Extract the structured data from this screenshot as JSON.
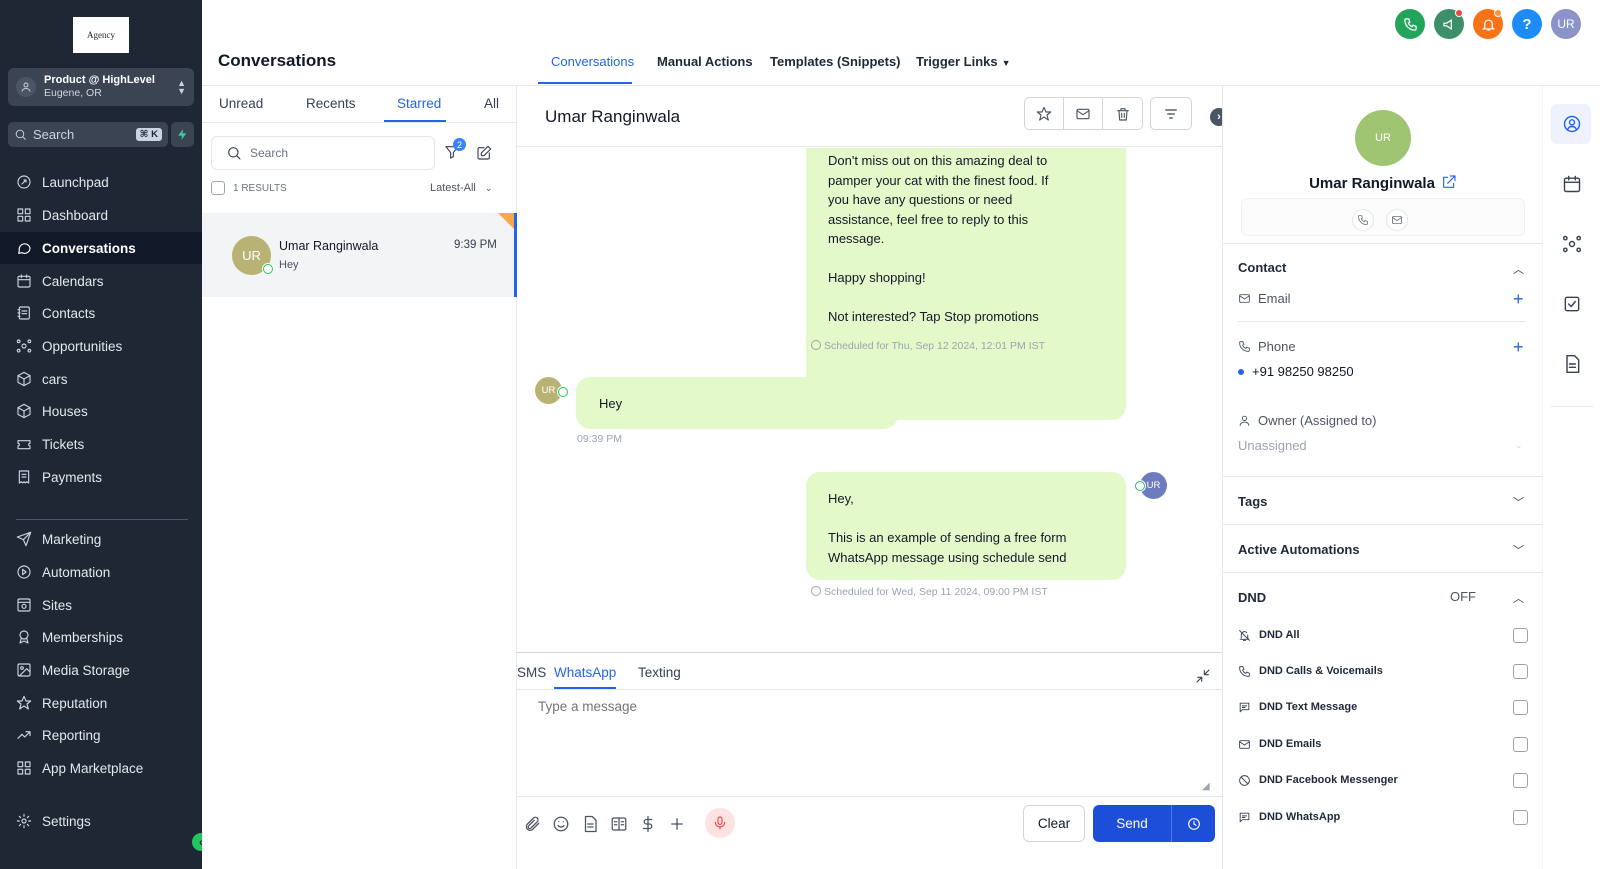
{
  "sidebar": {
    "logo_text": "Agency",
    "account": {
      "name": "Product @ HighLevel",
      "location": "Eugene, OR"
    },
    "search": {
      "placeholder": "Search",
      "shortcut": "⌘ K"
    },
    "nav_items": [
      {
        "label": "Launchpad",
        "icon": "rocket-icon"
      },
      {
        "label": "Dashboard",
        "icon": "grid-icon"
      },
      {
        "label": "Conversations",
        "icon": "chat-icon",
        "active": true
      },
      {
        "label": "Calendars",
        "icon": "calendar-icon"
      },
      {
        "label": "Contacts",
        "icon": "contacts-icon"
      },
      {
        "label": "Opportunities",
        "icon": "network-icon"
      },
      {
        "label": "cars",
        "icon": "box-icon"
      },
      {
        "label": "Houses",
        "icon": "box-icon"
      },
      {
        "label": "Tickets",
        "icon": "ticket-icon"
      },
      {
        "label": "Payments",
        "icon": "receipt-icon"
      }
    ],
    "nav_items_2": [
      {
        "label": "Marketing",
        "icon": "send-icon"
      },
      {
        "label": "Automation",
        "icon": "automation-icon"
      },
      {
        "label": "Sites",
        "icon": "globe-icon"
      },
      {
        "label": "Memberships",
        "icon": "award-icon"
      },
      {
        "label": "Media Storage",
        "icon": "image-icon"
      },
      {
        "label": "Reputation",
        "icon": "star-icon"
      },
      {
        "label": "Reporting",
        "icon": "trend-icon"
      },
      {
        "label": "App Marketplace",
        "icon": "grid-icon"
      }
    ],
    "settings_label": "Settings"
  },
  "header": {
    "title": "Conversations",
    "tabs": [
      "Conversations",
      "Manual Actions",
      "Templates (Snippets)",
      "Trigger Links"
    ],
    "active_tab": "Conversations",
    "user_initials": "UR",
    "colors": {
      "phone": "#22a55a",
      "announce": "#3d8f6a",
      "bell": "#f97316",
      "help": "#1d8cf8",
      "user": "#8b93c9"
    }
  },
  "conversation_list": {
    "filter_tabs": [
      "Unread",
      "Recents",
      "Starred",
      "All"
    ],
    "active_filter": "Starred",
    "search_placeholder": "Search",
    "filter_badge": "2",
    "results_label": "1 RESULTS",
    "sort_label": "Latest-All",
    "items": [
      {
        "initials": "UR",
        "name": "Umar Ranginwala",
        "preview": "Hey",
        "time": "9:39 PM"
      }
    ]
  },
  "chat": {
    "contact_name": "Umar Ranginwala",
    "messages": [
      {
        "direction": "out",
        "text": "Don't miss out on this amazing deal to\npamper your cat with the finest food. If\nyou have any questions or need\nassistance, feel free to reply to this\nmessage.\n\nHappy shopping!\n\n Not interested? Tap Stop promotions",
        "meta": "Scheduled for Thu, Sep 12 2024, 12:01 PM IST"
      },
      {
        "direction": "in",
        "initials": "UR",
        "text": "Hey",
        "meta": "09:39 PM"
      },
      {
        "direction": "out",
        "initials": "UR",
        "text": "Hey,\n\nThis is an example of sending a free form\nWhatsApp message using schedule send",
        "meta": "Scheduled for Wed, Sep 11 2024, 09:00 PM IST"
      }
    ],
    "composer": {
      "channels": [
        "SMS",
        "WhatsApp",
        "Texting"
      ],
      "active_channel": "WhatsApp",
      "placeholder": "Type a message",
      "clear_label": "Clear",
      "send_label": "Send"
    }
  },
  "contact_panel": {
    "initials": "UR",
    "name": "Umar Ranginwala",
    "section_contact": "Contact",
    "email_label": "Email",
    "phone_label": "Phone",
    "phone_value": "+91 98250 98250",
    "owner_label": "Owner (Assigned to)",
    "owner_value": "Unassigned",
    "tags_label": "Tags",
    "automations_label": "Active Automations",
    "dnd_label": "DND",
    "dnd_status": "OFF",
    "dnd_items": [
      {
        "label": "DND All",
        "icon": "bell-off-icon"
      },
      {
        "label": "DND Calls & Voicemails",
        "icon": "phone-icon"
      },
      {
        "label": "DND Text Message",
        "icon": "message-icon"
      },
      {
        "label": "DND Emails",
        "icon": "mail-icon"
      },
      {
        "label": "DND Facebook Messenger",
        "icon": "block-icon"
      },
      {
        "label": "DND WhatsApp",
        "icon": "message-icon"
      }
    ]
  },
  "right_rail": [
    "contact-icon",
    "calendar-icon",
    "opportunities-icon",
    "task-icon",
    "notes-icon"
  ]
}
